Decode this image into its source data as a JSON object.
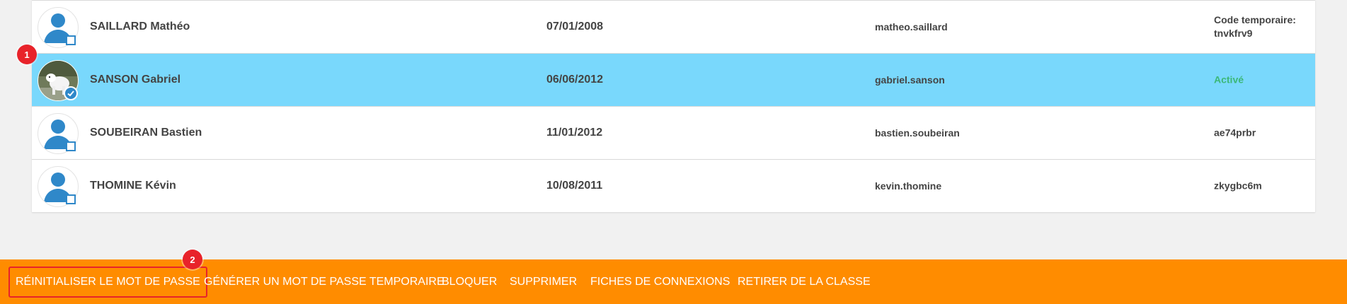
{
  "students": [
    {
      "name": "SAILLARD Mathéo",
      "dob": "07/01/2008",
      "login": "matheo.saillard",
      "password_line1": "Code temporaire:",
      "password_line2": "tnvkfrv9",
      "avatar": "default-user-icon",
      "selected": false
    },
    {
      "name": "SANSON Gabriel",
      "dob": "06/06/2012",
      "login": "gabriel.sanson",
      "password_line1": "Activé",
      "password_line2": "",
      "avatar": "photo-dog",
      "selected": true
    },
    {
      "name": "SOUBEIRAN Bastien",
      "dob": "11/01/2012",
      "login": "bastien.soubeiran",
      "password_line1": "ae74prbr",
      "password_line2": "",
      "avatar": "default-user-icon",
      "selected": false
    },
    {
      "name": "THOMINE Kévin",
      "dob": "10/08/2011",
      "login": "kevin.thomine",
      "password_line1": "zkygbc6m",
      "password_line2": "",
      "avatar": "default-user-icon",
      "selected": false
    }
  ],
  "annotations": [
    "1",
    "2"
  ],
  "toolbar": {
    "reset_password": "RÉINITIALISER LE MOT DE PASSE",
    "generate_temp_password": "GÉNÉRER UN MOT DE PASSE TEMPORAIRE",
    "block": "BLOQUER",
    "delete": "SUPPRIMER",
    "connection_sheets": "FICHES DE CONNEXIONS",
    "remove_from_class": "RETIRER DE LA CLASSE"
  },
  "colors": {
    "selected_row": "#79d8fc",
    "toolbar_bg": "#ff8c00",
    "active_status": "#3cb878",
    "annotation": "#e8232a",
    "avatar_blue": "#2f88c9"
  }
}
